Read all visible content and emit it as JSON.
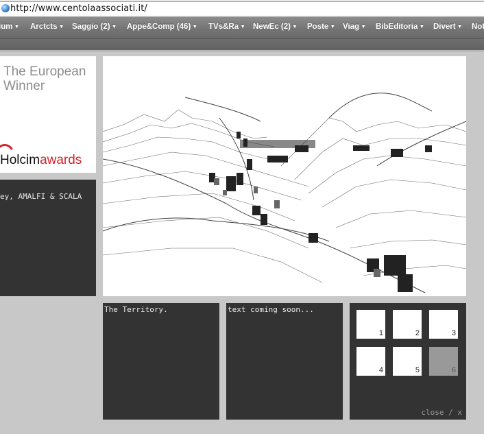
{
  "browser": {
    "url": "http://www.centolaassociati.it/",
    "bookmarks": [
      {
        "label": "ium"
      },
      {
        "label": "Arctcts"
      },
      {
        "label": "Saggio (2)"
      },
      {
        "label": "Appe&Comp (46)"
      },
      {
        "label": "TVs&Ra"
      },
      {
        "label": "NewEc (2)"
      },
      {
        "label": "Poste"
      },
      {
        "label": "Viag"
      },
      {
        "label": "BibEditoria"
      },
      {
        "label": "Divert"
      },
      {
        "label": "Not"
      }
    ]
  },
  "award": {
    "line1": "The European",
    "line2": "Winner",
    "logo_main": "Holcim",
    "logo_accent": "awards",
    "accent_color": "#d2232a"
  },
  "project": {
    "caption": "ey, AMALFI & SCALA"
  },
  "panels": {
    "territory": "The Territory.",
    "text": "text coming soon..."
  },
  "thumbnails": [
    "1",
    "2",
    "3",
    "4",
    "5",
    "6"
  ],
  "close_label": "close / x"
}
